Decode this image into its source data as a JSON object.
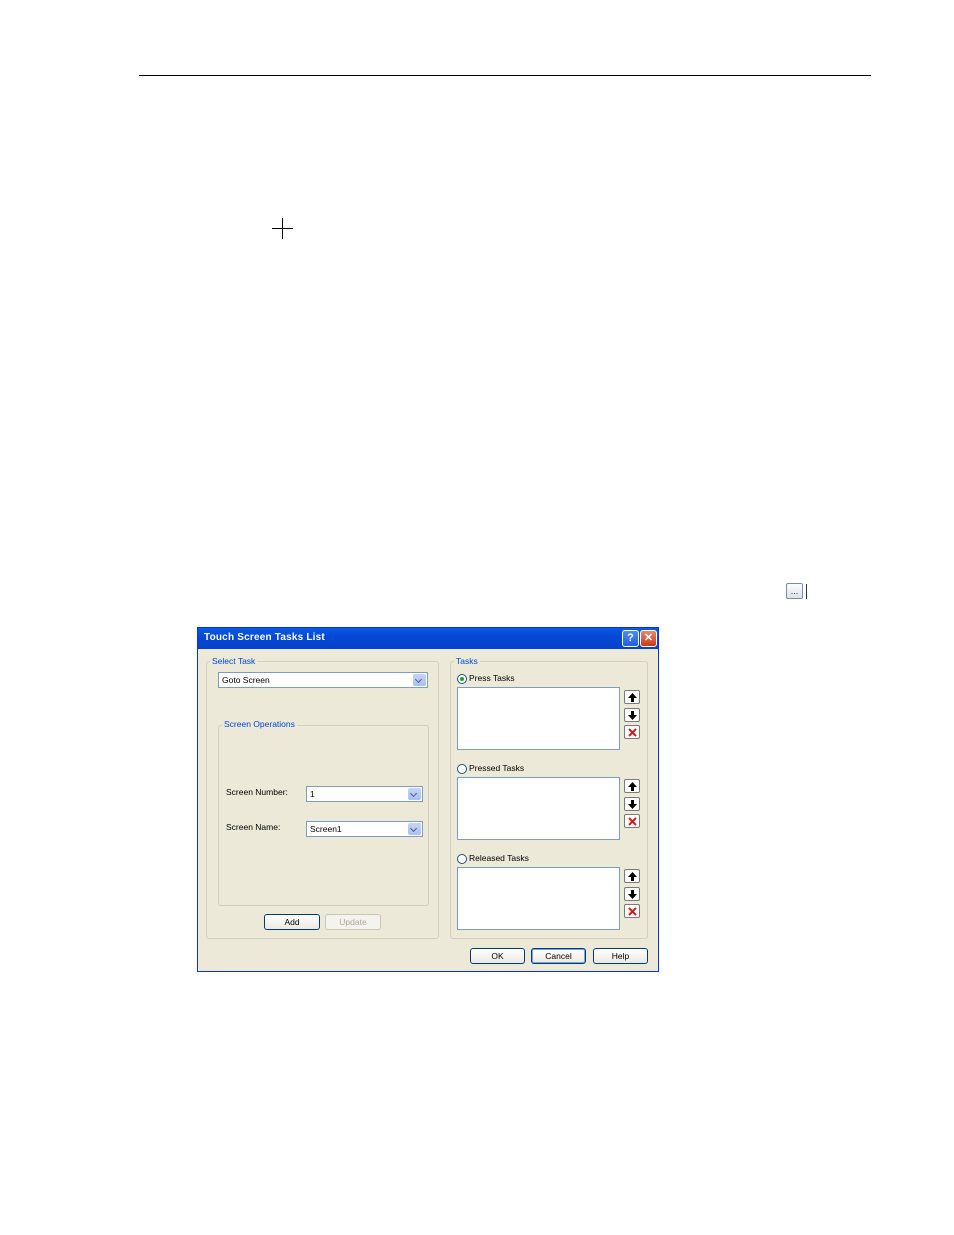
{
  "dialog": {
    "title": "Touch Screen Tasks List",
    "help_glyph": "?",
    "close_glyph": "✕"
  },
  "ellipsis_button": {
    "label": "..."
  },
  "select_task": {
    "legend": "Select Task",
    "selected": "Goto Screen"
  },
  "screen_operations": {
    "legend": "Screen Operations",
    "screen_number_label": "Screen Number:",
    "screen_number_value": "1",
    "screen_name_label": "Screen Name:",
    "screen_name_value": "Screen1"
  },
  "buttons": {
    "add": "Add",
    "update": "Update",
    "ok": "OK",
    "cancel": "Cancel",
    "help": "Help"
  },
  "tasks": {
    "legend": "Tasks",
    "lists": [
      {
        "label": "Press Tasks",
        "checked": true
      },
      {
        "label": "Pressed Tasks",
        "checked": false
      },
      {
        "label": "Released Tasks",
        "checked": false
      }
    ]
  },
  "colors": {
    "title_bar": "#0548d6",
    "dialog_face": "#ece9d8",
    "legend_text": "#0046d5",
    "delete_icon": "#d21b1b"
  }
}
